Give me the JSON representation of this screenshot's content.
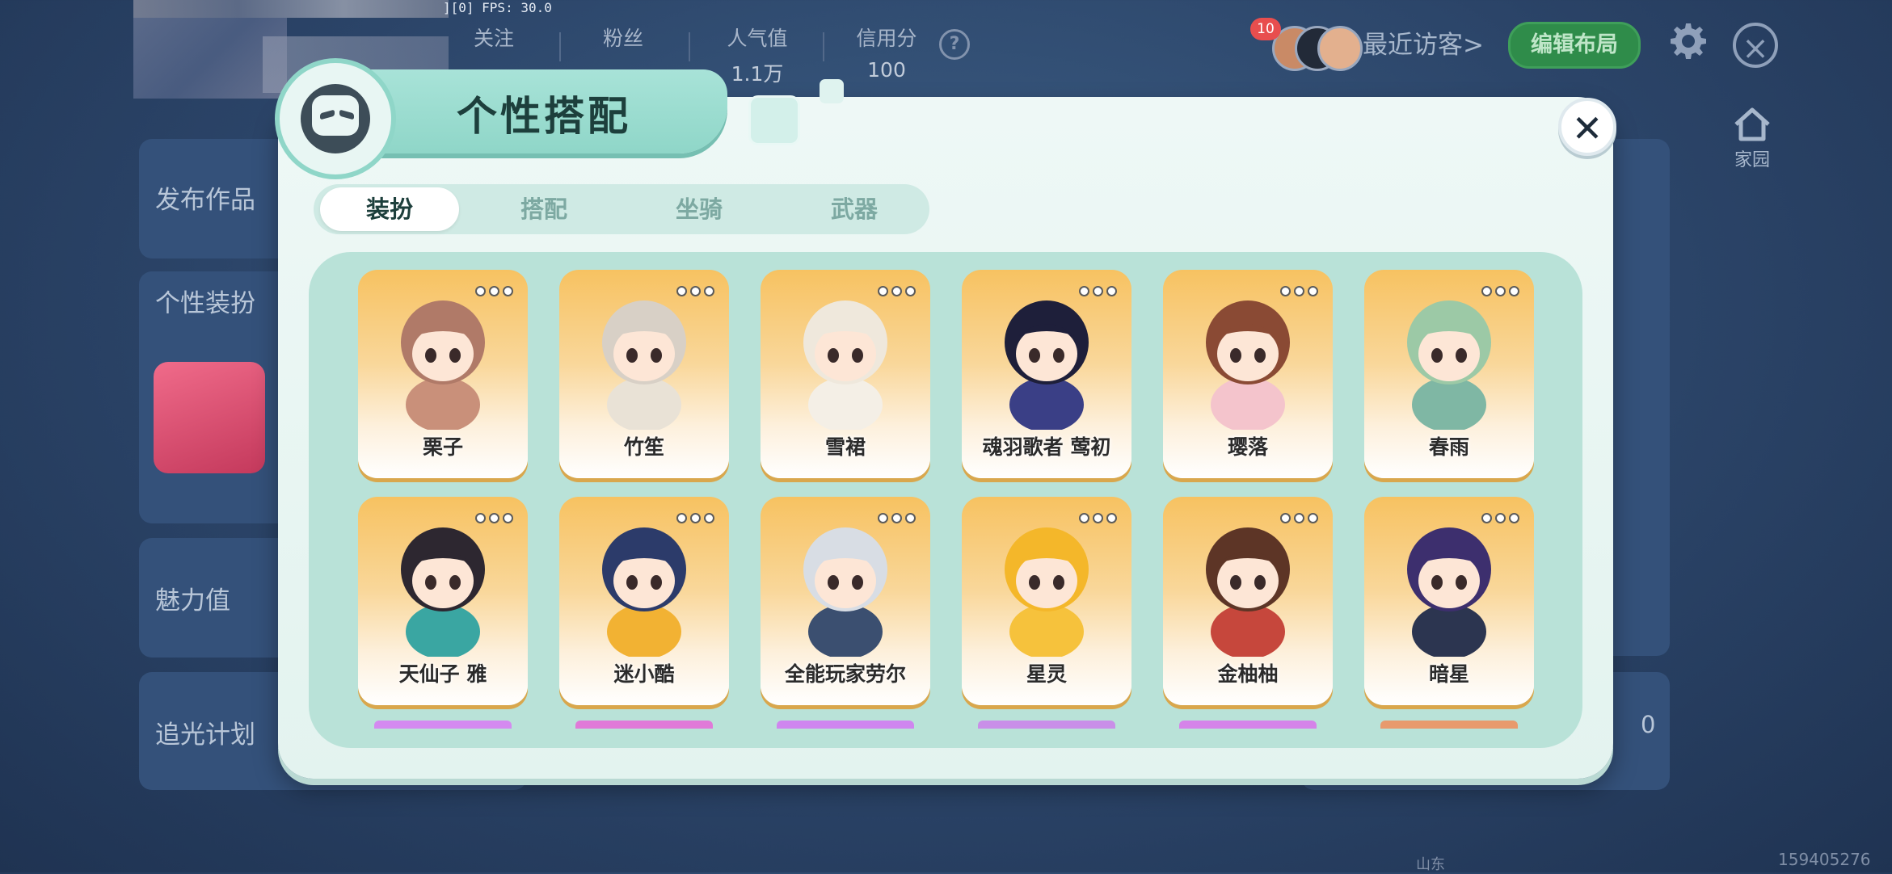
{
  "hud": {
    "fps_text": "][0] FPS: 30.0",
    "stats": [
      {
        "label": "关注",
        "value": ""
      },
      {
        "label": "粉丝",
        "value": ""
      },
      {
        "label": "人气值",
        "value": "1.1万"
      },
      {
        "label": "信用分",
        "value": "100"
      }
    ],
    "help_symbol": "?",
    "visitor_badge": "10",
    "recent_visitors": "最近访客>",
    "edit_layout": "编辑布局",
    "home_label": "家园"
  },
  "background": {
    "panels": [
      {
        "label": "发布作品"
      },
      {
        "label": "个性装扮"
      },
      {
        "label": "魅力值"
      },
      {
        "label": "追光计划"
      }
    ],
    "right_value": "0",
    "player_id": "159405276",
    "location": "山东"
  },
  "modal": {
    "title": "个性搭配",
    "close_symbol": "✕",
    "tabs": [
      {
        "label": "装扮",
        "active": true
      },
      {
        "label": "搭配",
        "active": false
      },
      {
        "label": "坐骑",
        "active": false
      },
      {
        "label": "武器",
        "active": false
      }
    ],
    "items": [
      {
        "name": "栗子",
        "color": "#c9907a",
        "hair": "#b07a68"
      },
      {
        "name": "竹笙",
        "color": "#e9e2d6",
        "hair": "#d8d0c6"
      },
      {
        "name": "雪裙",
        "color": "#f4efe6",
        "hair": "#efe8dc"
      },
      {
        "name": "魂羽歌者 莺初",
        "color": "#3a3f86",
        "hair": "#1e1f3a"
      },
      {
        "name": "璎落",
        "color": "#f4c4cc",
        "hair": "#8a4a34"
      },
      {
        "name": "春雨",
        "color": "#7fb7a4",
        "hair": "#9cc9a6"
      },
      {
        "name": "天仙子 雅",
        "color": "#3aa6a2",
        "hair": "#2d2730"
      },
      {
        "name": "迷小酷",
        "color": "#f2b233",
        "hair": "#2c3b6a"
      },
      {
        "name": "全能玩家劳尔",
        "color": "#3b4f70",
        "hair": "#d8dde4"
      },
      {
        "name": "星灵",
        "color": "#f6c23c",
        "hair": "#f4b72a"
      },
      {
        "name": "金柚柚",
        "color": "#c6473c",
        "hair": "#5d3526"
      },
      {
        "name": "暗星",
        "color": "#2c3550",
        "hair": "#3d2f6e"
      }
    ]
  }
}
